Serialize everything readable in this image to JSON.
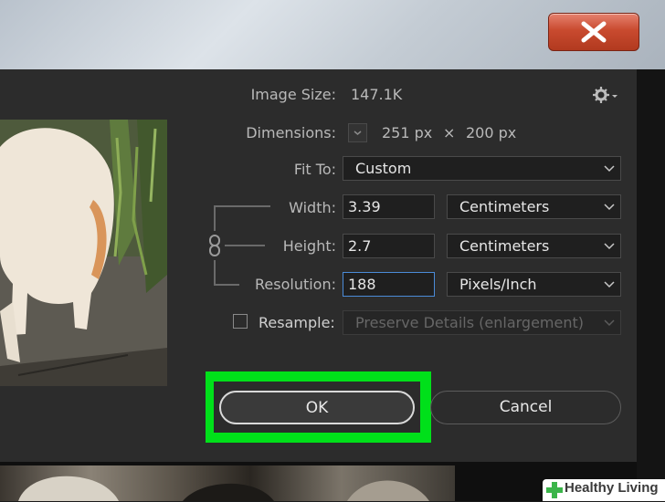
{
  "window": {
    "close_icon": "close-x-icon"
  },
  "image_size": {
    "label": "Image Size:",
    "value": "147.1K"
  },
  "dimensions": {
    "label": "Dimensions:",
    "width": "251 px",
    "times": "×",
    "height": "200 px"
  },
  "fit_to": {
    "label": "Fit To:",
    "value": "Custom"
  },
  "width": {
    "label": "Width:",
    "value": "3.39",
    "unit": "Centimeters"
  },
  "height": {
    "label": "Height:",
    "value": "2.7",
    "unit": "Centimeters"
  },
  "resolution": {
    "label": "Resolution:",
    "value": "188",
    "unit": "Pixels/Inch"
  },
  "resample": {
    "label": "Resample:",
    "value": "Preserve Details (enlargement)",
    "checked": false
  },
  "buttons": {
    "ok": "OK",
    "cancel": "Cancel"
  },
  "watermark": {
    "text": "Healthy Living"
  },
  "colors": {
    "dialog_bg": "#2c2c2c",
    "highlight": "#00e01a",
    "active_field_border": "#4b8bd8",
    "close_button": "#c94a2f"
  }
}
